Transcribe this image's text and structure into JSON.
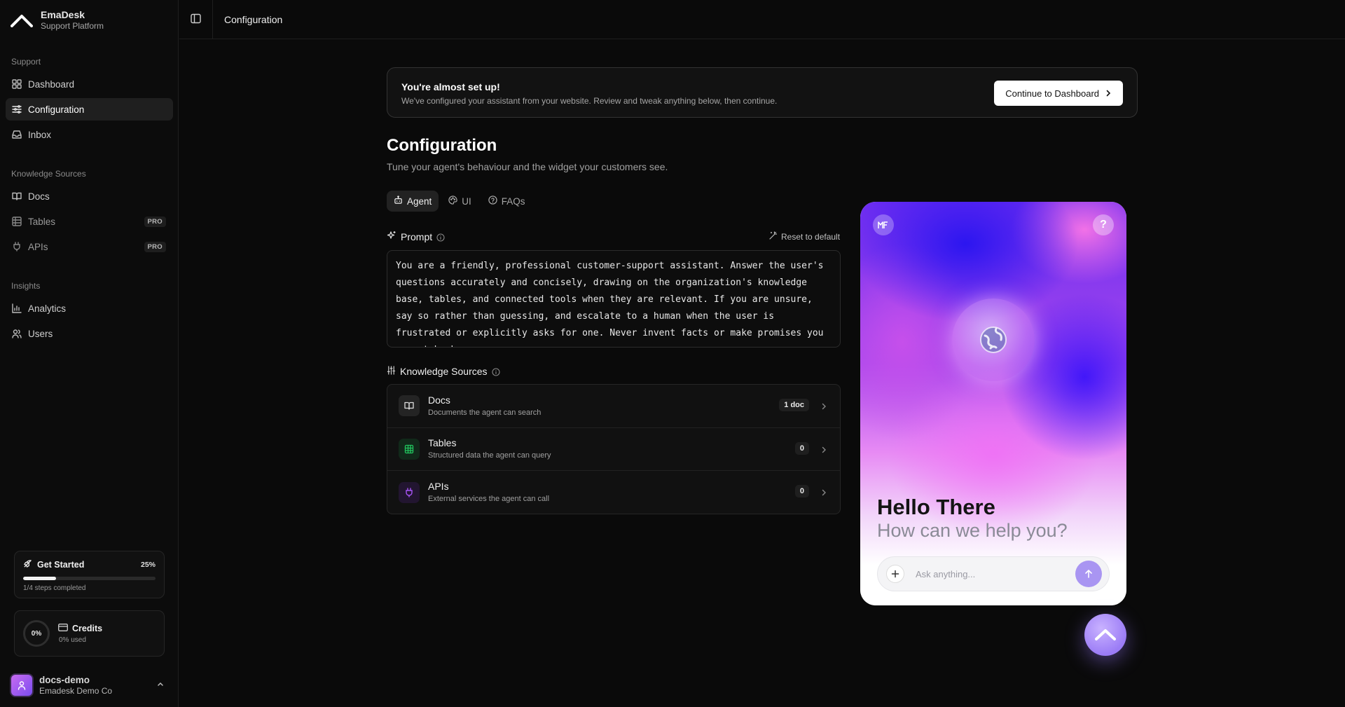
{
  "brand": {
    "name": "EmaDesk",
    "subtitle": "Support Platform"
  },
  "nav": {
    "support_heading": "Support",
    "support": [
      {
        "label": "Dashboard",
        "icon": "dashboard-grid-icon"
      },
      {
        "label": "Configuration",
        "icon": "sliders-icon",
        "active": true
      },
      {
        "label": "Inbox",
        "icon": "inbox-icon"
      }
    ],
    "knowledge_heading": "Knowledge Sources",
    "knowledge": [
      {
        "label": "Docs",
        "icon": "book-icon"
      },
      {
        "label": "Tables",
        "icon": "table-icon",
        "badge": "PRO"
      },
      {
        "label": "APIs",
        "icon": "plug-icon",
        "badge": "PRO"
      }
    ],
    "insights_heading": "Insights",
    "insights": [
      {
        "label": "Analytics",
        "icon": "bar-chart-icon"
      },
      {
        "label": "Users",
        "icon": "users-icon"
      }
    ]
  },
  "get_started": {
    "title": "Get Started",
    "percent": "25%",
    "progress": 0.25,
    "steps": "1/4 steps completed"
  },
  "credits": {
    "title": "Credits",
    "ring_label": "0%",
    "used": "0% used"
  },
  "user": {
    "name": "docs-demo",
    "org": "Emadesk Demo Co"
  },
  "topbar": {
    "title": "Configuration"
  },
  "banner": {
    "title": "You're almost set up!",
    "subtitle": "We've configured your assistant from your website. Review and tweak anything below, then continue.",
    "button": "Continue to Dashboard"
  },
  "page": {
    "title": "Configuration",
    "subtitle": "Tune your agent's behaviour and the widget your customers see."
  },
  "tabs": [
    {
      "label": "Agent",
      "icon": "robot-icon",
      "active": true
    },
    {
      "label": "UI",
      "icon": "palette-icon"
    },
    {
      "label": "FAQs",
      "icon": "question-circle-icon"
    }
  ],
  "prompt": {
    "label": "Prompt",
    "reset": "Reset to default",
    "text": "You are a friendly, professional customer-support assistant. Answer the user's questions accurately and concisely, drawing on the organization's knowledge base, tables, and connected tools when they are relevant. If you are unsure, say so rather than guessing, and escalate to a human when the user is frustrated or explicitly asks for one. Never invent facts or make promises you cannot back up."
  },
  "knowledge_sources": {
    "label": "Knowledge Sources",
    "items": [
      {
        "name": "Docs",
        "desc": "Documents the agent can search",
        "count": "1 doc",
        "icon": "book-open-icon",
        "color": "#d8d8d8"
      },
      {
        "name": "Tables",
        "desc": "Structured data the agent can query",
        "count": "0",
        "icon": "table-icon",
        "color": "#22c55e"
      },
      {
        "name": "APIs",
        "desc": "External services the agent can call",
        "count": "0",
        "icon": "plug-icon",
        "color": "#a855f7"
      }
    ]
  },
  "widget": {
    "greeting": "Hello There",
    "subgreeting": "How can we help you?",
    "input_placeholder": "Ask anything...",
    "accent": "#a995f2"
  }
}
